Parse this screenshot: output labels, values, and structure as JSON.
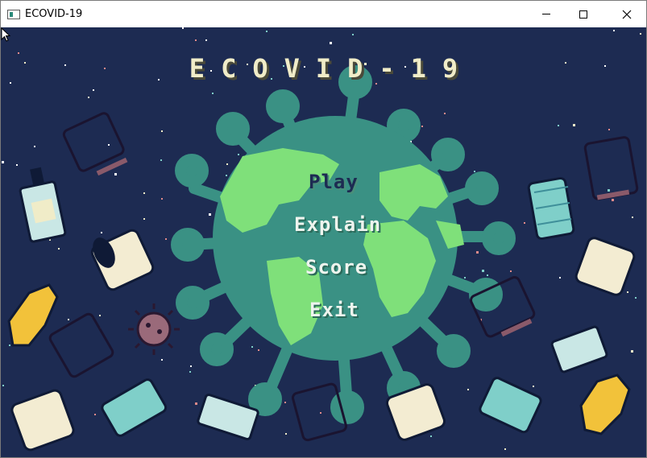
{
  "window": {
    "title": "ECOVID-19",
    "controls": {
      "minimize": "minimize",
      "maximize": "maximize",
      "close": "close"
    }
  },
  "game": {
    "title": "ECOVID-19",
    "menu": {
      "play": "Play",
      "explain": "Explain",
      "score": "Score",
      "exit": "Exit"
    }
  },
  "colors": {
    "background": "#1d2b52",
    "virus": "#3a9184",
    "land": "#7fe07a",
    "title": "#f0ecc8"
  },
  "icons": [
    "window-app-icon",
    "virus-globe",
    "face-mask-icon",
    "hand-sanitizer-icon",
    "toilet-paper-icon",
    "rubber-glove-icon",
    "virus-germ-icon",
    "mouse-cursor-icon"
  ]
}
